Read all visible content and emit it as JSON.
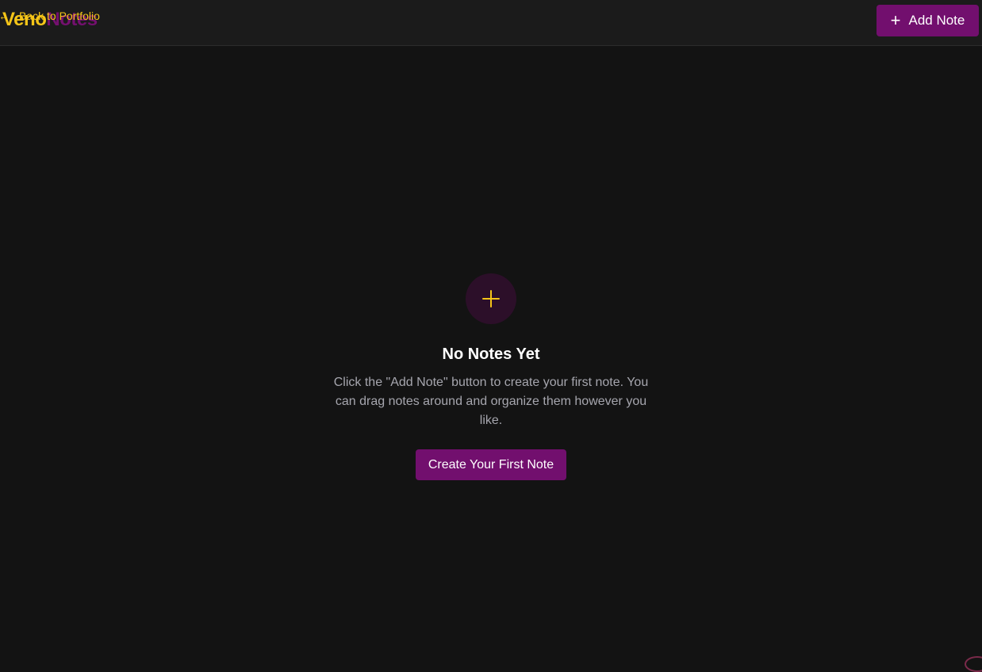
{
  "header": {
    "brand_part1": "Veno",
    "brand_part2": "Notes",
    "back_link_arrow": "←",
    "back_link_label": "Back to Portfolio",
    "add_note_icon": "+",
    "add_note_label": "Add Note"
  },
  "empty_state": {
    "icon": "plus-icon",
    "title": "No Notes Yet",
    "description": "Click the \"Add Note\" button to create your first note. You can drag notes around and organize them however you like.",
    "create_button_label": "Create Your First Note"
  },
  "colors": {
    "background": "#131313",
    "header_bg": "#1b1b1b",
    "accent_purple": "#720f6e",
    "accent_yellow": "#f5c518",
    "icon_circle_bg": "#2c0f29",
    "muted_text": "#a6a6ae"
  }
}
